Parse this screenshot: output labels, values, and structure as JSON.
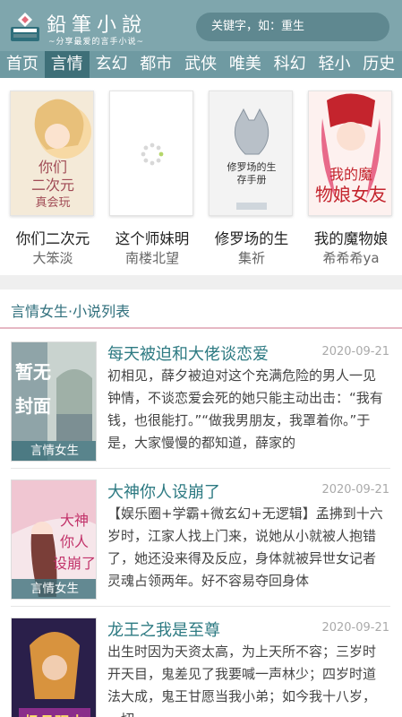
{
  "header": {
    "logo_title": "鉛筆小說",
    "logo_subtitle": "~分享最爱的言手小说~",
    "search_placeholder": "关键字，如：重生"
  },
  "nav": [
    "首页",
    "言情",
    "玄幻",
    "都市",
    "武侠",
    "唯美",
    "科幻",
    "轻小",
    "历史"
  ],
  "nav_active_index": 1,
  "featured": [
    {
      "title": "你们二次元",
      "author": "大笨淡",
      "cover_text": "你们二次元真会玩"
    },
    {
      "title": "这个师妹明",
      "author": "南楼北望",
      "cover_text": ""
    },
    {
      "title": "修罗场的生",
      "author": "集祈",
      "cover_text": "修罗场的生存手册"
    },
    {
      "title": "我的魔物娘",
      "author": "希希希ya",
      "cover_text": "我的魔物娘女友"
    }
  ],
  "section": {
    "title": "言情女生·小说列表"
  },
  "list": [
    {
      "title": "每天被迫和大佬谈恋爱",
      "date": "2020-09-21",
      "desc": "初相见，薛夕被迫对这个充满危险的男人一见钟情，不谈恋爱会死的她只能主动出击：“我有钱，也很能打。”“做我男朋友，我罩着你。”于是，大家慢慢的都知道，薛家的",
      "tag": "言情女生",
      "cover_text": "暂无封面"
    },
    {
      "title": "大神你人设崩了",
      "date": "2020-09-21",
      "desc": "【娱乐圈+学霸+微玄幻+无逻辑】孟拂到十六岁时，江家人找上门来，说她从小就被人抱错了，她还没来得及反应，身体就被异世女记者灵魂占领两年。好不容易夺回身体",
      "tag": "言情女生",
      "cover_text": "大神你人设崩了"
    },
    {
      "title": "龙王之我是至尊",
      "date": "2020-09-21",
      "desc": "出生时因为天资太高，为上天所不容；三岁时开天目，鬼差见了我要喊一声林少；四岁时道法大成，鬼王甘愿当我小弟；如今我十八岁，一切",
      "tag": "",
      "cover_text": "极品强少"
    }
  ],
  "colors": {
    "header_bg": "#7fa6ad",
    "nav_bg": "#6f9aa2",
    "nav_active_bg": "#3e6f78",
    "title_accent": "#2d7a82"
  }
}
